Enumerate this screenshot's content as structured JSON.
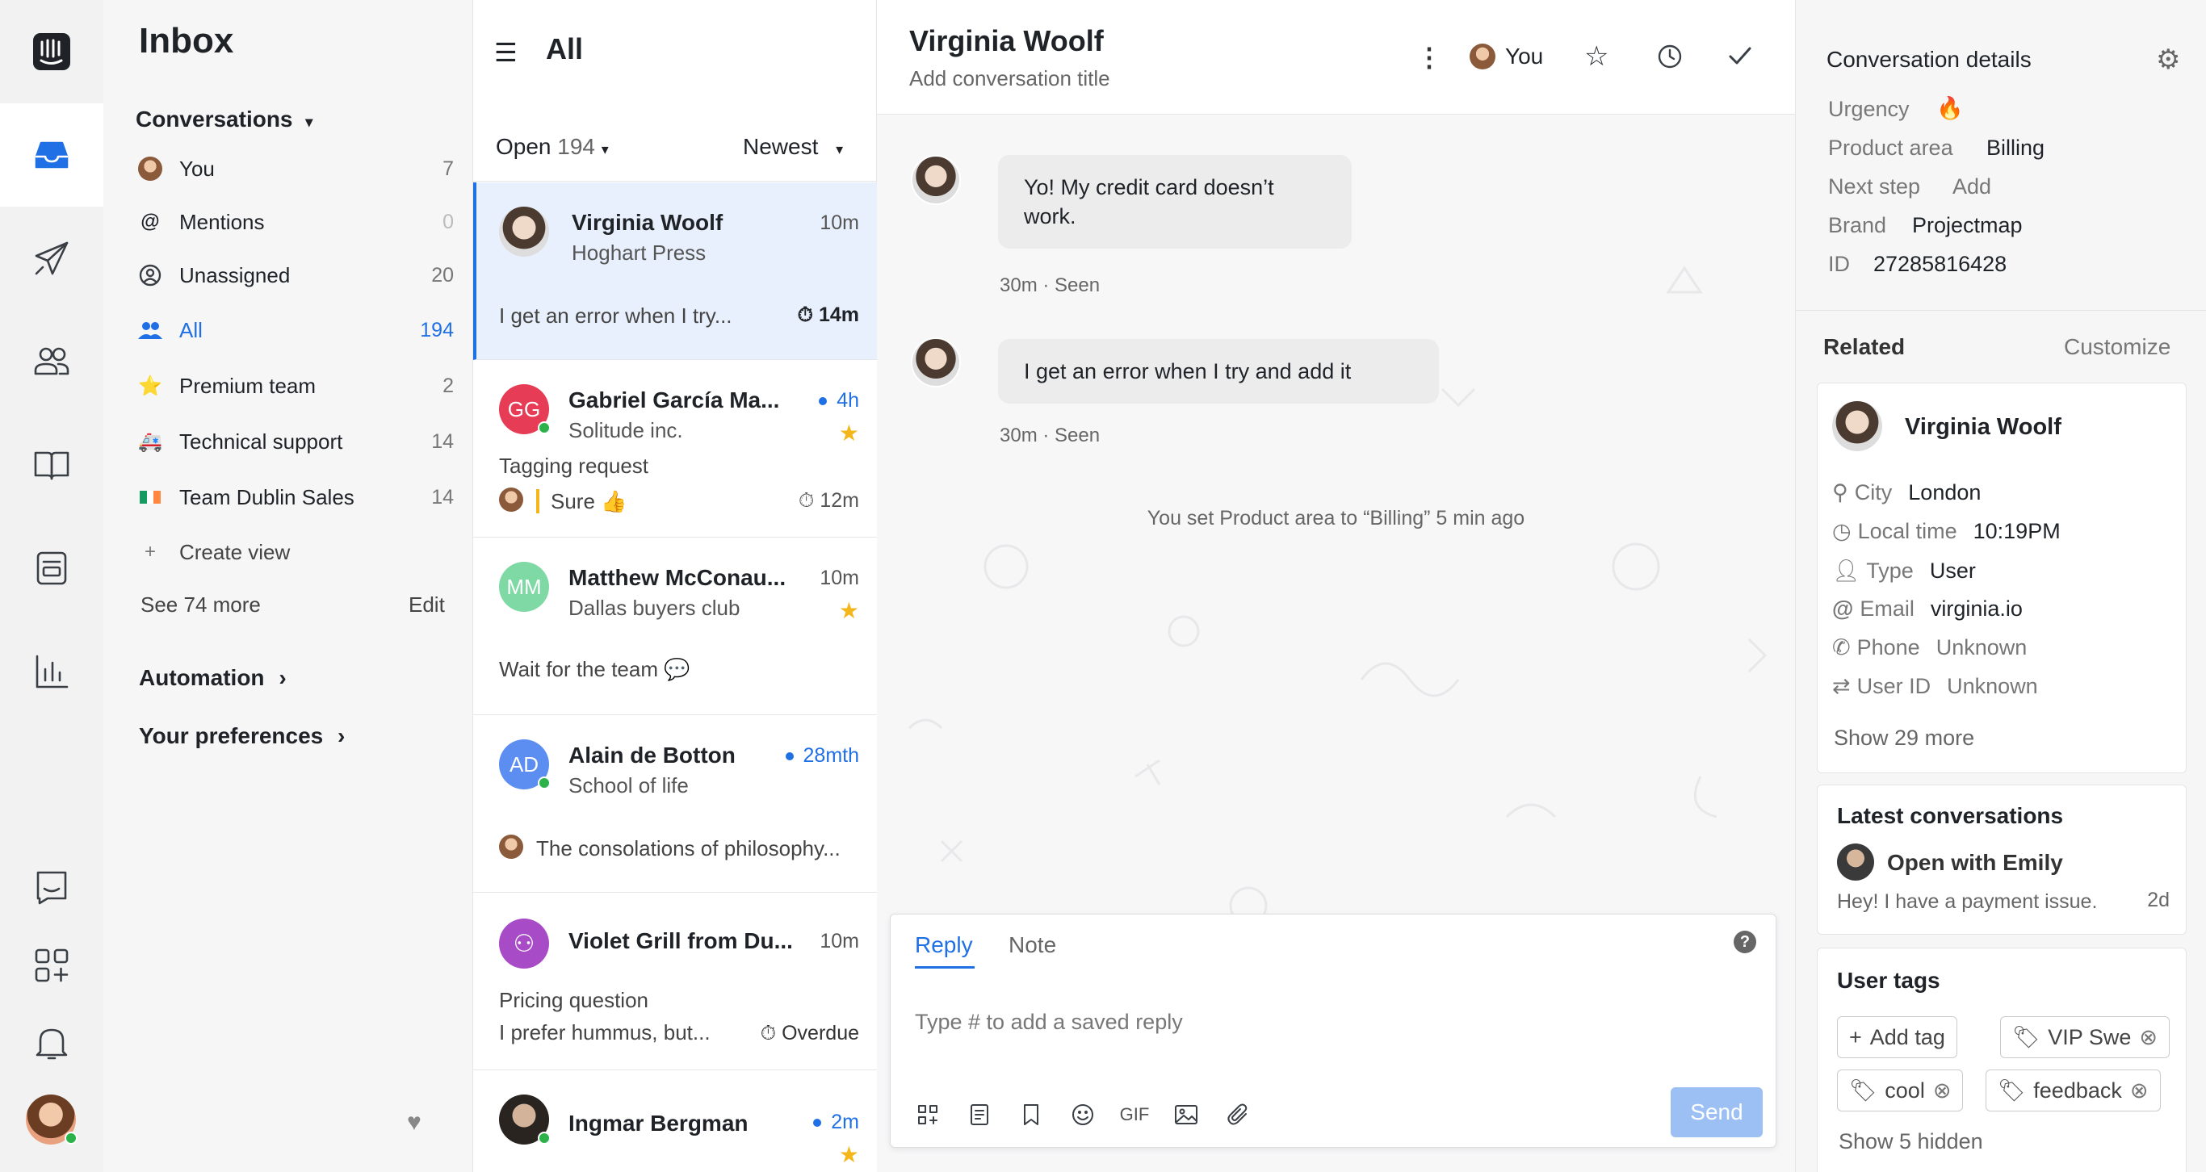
{
  "rail": {
    "items": [
      "intercom-logo",
      "inbox-icon",
      "outbound-icon",
      "contacts-icon",
      "articles-icon",
      "reports-docs-icon",
      "reports-icon",
      "messenger-icon",
      "apps-icon",
      "notifications-icon",
      "user-avatar"
    ]
  },
  "sidebar": {
    "title": "Inbox",
    "conversations_label": "Conversations",
    "items": [
      {
        "label": "You",
        "count": "7",
        "icon": "avatar"
      },
      {
        "label": "Mentions",
        "count": "0",
        "icon": "at-icon"
      },
      {
        "label": "Unassigned",
        "count": "20",
        "icon": "unassigned-icon"
      },
      {
        "label": "All",
        "count": "194",
        "icon": "team-icon"
      },
      {
        "label": "Premium team",
        "count": "2",
        "icon": "⭐"
      },
      {
        "label": "Technical support",
        "count": "14",
        "icon": "🚑"
      },
      {
        "label": "Team Dublin Sales",
        "count": "14",
        "icon": "🇮🇪"
      }
    ],
    "create_view": "Create view",
    "see_more": "See 74 more",
    "edit": "Edit",
    "automation": "Automation",
    "preferences": "Your preferences"
  },
  "list": {
    "title": "All",
    "filter_label": "Open",
    "filter_count": "194",
    "sort_label": "Newest",
    "cards": [
      {
        "name": "Virginia Woolf",
        "sub": "Hoghart Press",
        "time": "10m",
        "snippet": "I get an error when I try...",
        "sla": "14m"
      },
      {
        "name": "Gabriel García Ma...",
        "sub": "Solitude inc.",
        "time": "4h",
        "initials": "GG",
        "subject": "Tagging request",
        "snippet": "Sure 👍",
        "sla": "12m"
      },
      {
        "name": "Matthew McConau...",
        "sub": "Dallas buyers club",
        "time": "10m",
        "initials": "MM",
        "snippet": "Wait for the team 💬"
      },
      {
        "name": "Alain de Botton",
        "sub": "School of life",
        "time": "28mth",
        "initials": "AD",
        "snippet": "The consolations of philosophy..."
      },
      {
        "name": "Violet Grill from Du...",
        "time": "10m",
        "subject": "Pricing question",
        "snippet": "I prefer hummus, but...",
        "sla": "Overdue"
      },
      {
        "name": "Ingmar Bergman",
        "time": "2m"
      }
    ]
  },
  "conversation": {
    "title": "Virginia Woolf",
    "subtitle": "Add conversation title",
    "assignee": "You",
    "messages": [
      {
        "text": "Yo! My credit card doesn’t work.",
        "meta": "30m · Seen"
      },
      {
        "text": "I get an error when I try and add it",
        "meta": "30m · Seen"
      }
    ],
    "event": "You set Product area to “Billing” 5 min ago",
    "composer": {
      "tab_reply": "Reply",
      "tab_note": "Note",
      "placeholder": "Type # to add a saved reply",
      "gif": "GIF",
      "send": "Send"
    }
  },
  "details": {
    "title": "Conversation details",
    "attrs": [
      {
        "label": "Urgency",
        "value": "🔥"
      },
      {
        "label": "Product area",
        "value": "Billing"
      },
      {
        "label": "Next step",
        "value": "Add"
      },
      {
        "label": "Brand",
        "value": "Projectmap"
      },
      {
        "label": "ID",
        "value": "27285816428"
      }
    ],
    "related": "Related",
    "customize": "Customize",
    "contact": {
      "name": "Virginia Woolf",
      "rows": [
        {
          "k": "City",
          "v": "London"
        },
        {
          "k": "Local time",
          "v": "10:19PM"
        },
        {
          "k": "Type",
          "v": "User"
        },
        {
          "k": "Email",
          "v": "virginia.io"
        },
        {
          "k": "Phone",
          "v": "Unknown"
        },
        {
          "k": "User ID",
          "v": "Unknown"
        }
      ],
      "show_more": "Show 29 more"
    },
    "latest": {
      "title": "Latest conversations",
      "item_title": "Open with Emily",
      "item_snippet": "Hey! I have a payment issue.",
      "item_time": "2d"
    },
    "tags": {
      "title": "User tags",
      "add": "Add tag",
      "items": [
        "VIP Swe",
        "cool",
        "feedback"
      ],
      "show_hidden": "Show 5 hidden"
    }
  },
  "colors": {
    "accent": "#1f6fe5",
    "send": "#9cc0f4",
    "star": "#f3b71c",
    "online": "#2bb34a"
  }
}
